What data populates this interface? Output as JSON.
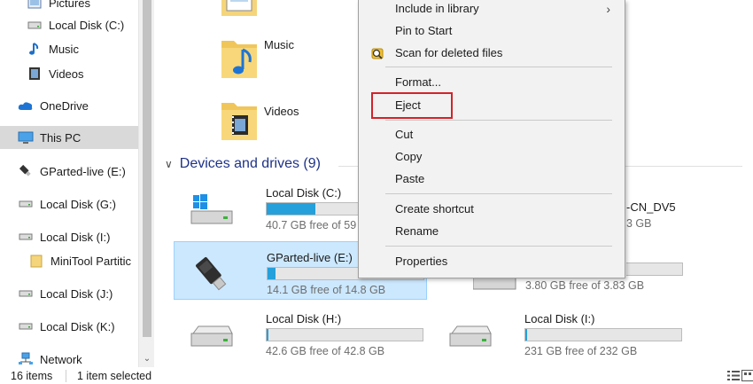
{
  "nav": {
    "items": [
      {
        "label": "Pictures",
        "icon": "pictures-folder-icon"
      },
      {
        "label": "Local Disk (C:)",
        "icon": "drive-icon"
      },
      {
        "label": "Music",
        "icon": "music-icon"
      },
      {
        "label": "Videos",
        "icon": "videos-icon"
      },
      {
        "label": "OneDrive",
        "icon": "onedrive-icon"
      },
      {
        "label": "This PC",
        "icon": "this-pc-icon"
      },
      {
        "label": "GParted-live (E:)",
        "icon": "usb-drive-icon"
      },
      {
        "label": "Local Disk (G:)",
        "icon": "drive-icon"
      },
      {
        "label": "Local Disk (I:)",
        "icon": "drive-icon"
      },
      {
        "label": "MiniTool Partitic",
        "icon": "folder-icon"
      },
      {
        "label": "Local Disk (J:)",
        "icon": "drive-icon"
      },
      {
        "label": "Local Disk (K:)",
        "icon": "drive-icon"
      },
      {
        "label": "Network",
        "icon": "network-icon"
      }
    ]
  },
  "content": {
    "folders": [
      {
        "name": "Music",
        "icon": "music-folder-icon"
      },
      {
        "name": "Videos",
        "icon": "videos-folder-icon"
      }
    ],
    "section_title": "Devices and drives (9)",
    "drives": [
      {
        "name": "Local Disk (C:)",
        "free": "40.7 GB free of 59",
        "used_fraction": 0.31,
        "icon": "windows-drive-icon"
      },
      {
        "name": "GParted-live (E:)",
        "free": "14.1 GB free of 14.8 GB",
        "used_fraction": 0.05,
        "icon": "usb-drive-icon"
      },
      {
        "name": "Local Disk (H:)",
        "free": "42.6 GB free of 42.8 GB",
        "used_fraction": 0.005,
        "icon": "drive-icon"
      },
      {
        "name": "Local Disk (I:)",
        "free": "231 GB free of 232 GB",
        "used_fraction": 0.005,
        "icon": "drive-icon"
      }
    ],
    "partial": {
      "top_right_name": "-CN_DV5",
      "top_right_free": "3 GB",
      "mid_right_free": "3.80 GB free of 3.83 GB"
    }
  },
  "context_menu": {
    "items": [
      {
        "label": "Include in library",
        "has_submenu": true
      },
      {
        "label": "Pin to Start"
      },
      {
        "label": "Scan for deleted files",
        "icon": "scan-icon"
      },
      {
        "label": "Format..."
      },
      {
        "label": "Eject"
      },
      {
        "label": "Cut"
      },
      {
        "label": "Copy"
      },
      {
        "label": "Paste"
      },
      {
        "label": "Create shortcut"
      },
      {
        "label": "Rename"
      },
      {
        "label": "Properties"
      }
    ],
    "highlight_color": "#d2232a"
  },
  "status": {
    "items_count": "16 items",
    "selected": "1 item selected"
  },
  "colors": {
    "accent": "#26a0da",
    "selection": "#cce8ff",
    "section_header": "#1e3287"
  }
}
